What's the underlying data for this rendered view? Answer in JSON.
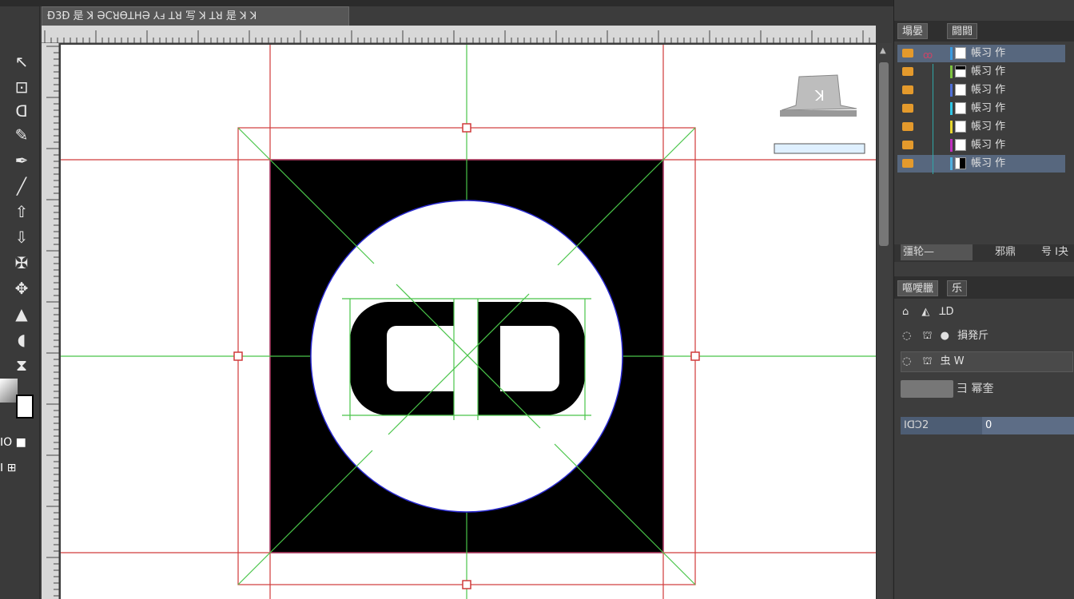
{
  "document": {
    "tab_title": "Ð3Ð 是 ꓘ̇ ƏϹꓤƟꓕꓧƏ ⅄ⅎ ꓕꓤ 写 ꓘ ꓕꓤ 是 ꓘ ꓘ"
  },
  "toolbox": {
    "tools": [
      {
        "icon": "move-tool-icon",
        "glyph": "↖"
      },
      {
        "icon": "marquee-tool-icon",
        "glyph": "⊡"
      },
      {
        "icon": "lasso-tool-icon",
        "glyph": "ᗡ"
      },
      {
        "icon": "brush-tool-icon",
        "glyph": "✎"
      },
      {
        "icon": "pen-tool-icon",
        "glyph": "✒"
      },
      {
        "icon": "line-tool-icon",
        "glyph": "╱"
      },
      {
        "icon": "arrow-up-tool-icon",
        "glyph": "⇧"
      },
      {
        "icon": "arrow-down-tool-icon",
        "glyph": "⇩"
      },
      {
        "icon": "pin-tool-icon",
        "glyph": "✠"
      },
      {
        "icon": "transform-tool-icon",
        "glyph": "✥"
      },
      {
        "icon": "triangle-tool-icon",
        "glyph": "▲"
      },
      {
        "icon": "shape-tool-icon",
        "glyph": "◖"
      },
      {
        "icon": "hourglass-tool-icon",
        "glyph": "⧗"
      }
    ],
    "mode_label": "ꓲO ■",
    "screen_mode_label": "ꓲ ⊞"
  },
  "panels": {
    "layers_tab": "塌晏",
    "channels_tab": "闘闘",
    "layers": [
      {
        "name": "帳习 作",
        "color": "#3a9be0"
      },
      {
        "name": "帳习 作",
        "color": "#7dc23f"
      },
      {
        "name": "帳习 作",
        "color": "#4f6fd8"
      },
      {
        "name": "帳习 作",
        "color": "#2ec6e6"
      },
      {
        "name": "帳习 作",
        "color": "#e6d52e"
      },
      {
        "name": "帳习 作",
        "color": "#c02fbf"
      },
      {
        "name": "帳习 作",
        "color": "#4fb0e0"
      }
    ],
    "layer_footer": {
      "left": "彊轮—",
      "mid": "邪鼎",
      "right": "号 ꓲ夬"
    },
    "properties_tab": "嘔噯臘",
    "properties_tab2": "乐",
    "prop_rows": [
      {
        "label": "ꓕD"
      },
      {
        "label": "損発斤"
      },
      {
        "label": "虫 W"
      },
      {
        "label": "彐 幂奎"
      }
    ],
    "field_label": "ꓲꓷꓛ2",
    "field_value": "0"
  }
}
